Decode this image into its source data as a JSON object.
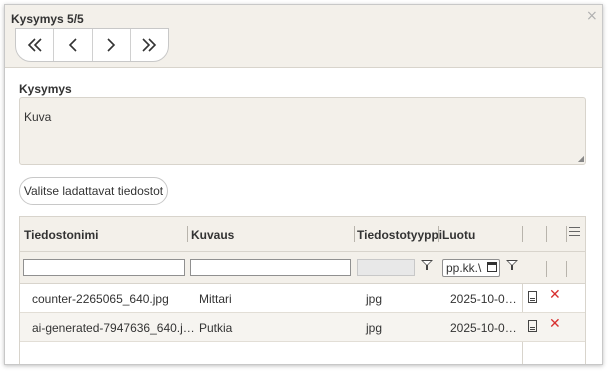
{
  "dialog": {
    "title": "Kysymys 5/5",
    "close_glyph": "×"
  },
  "nav": {
    "first": "«",
    "prev": "‹",
    "next": "›",
    "last": "»"
  },
  "question": {
    "label": "Kysymys",
    "text": "Kuva"
  },
  "select_files_button": "Valitse ladattavat tiedostot",
  "grid": {
    "columns": [
      "Tiedostonimi",
      "Kuvaus",
      "Tiedostotyyppi",
      "Luotu"
    ],
    "date_filter_placeholder": "pp.kk.vvvv",
    "date_filter_display": "pp.kk.\\",
    "rows": [
      {
        "name": "counter-2265065_640.jpg",
        "description": "Mittari",
        "type": "jpg",
        "created": "2025-10-0…"
      },
      {
        "name": "ai-generated-7947636_640.j…",
        "description": "Putkia",
        "type": "jpg",
        "created": "2025-10-0…"
      }
    ]
  },
  "icons": {
    "close": "close-icon",
    "first": "double-chevron-left-icon",
    "prev": "chevron-left-icon",
    "next": "chevron-right-icon",
    "last": "double-chevron-right-icon",
    "filter": "filter-icon",
    "calendar": "calendar-icon",
    "column_menu": "hamburger-menu-icon",
    "view_file": "document-icon",
    "delete": "delete-x-icon"
  },
  "colors": {
    "header_bg": "#f3f0ea",
    "delete": "#d83030"
  }
}
